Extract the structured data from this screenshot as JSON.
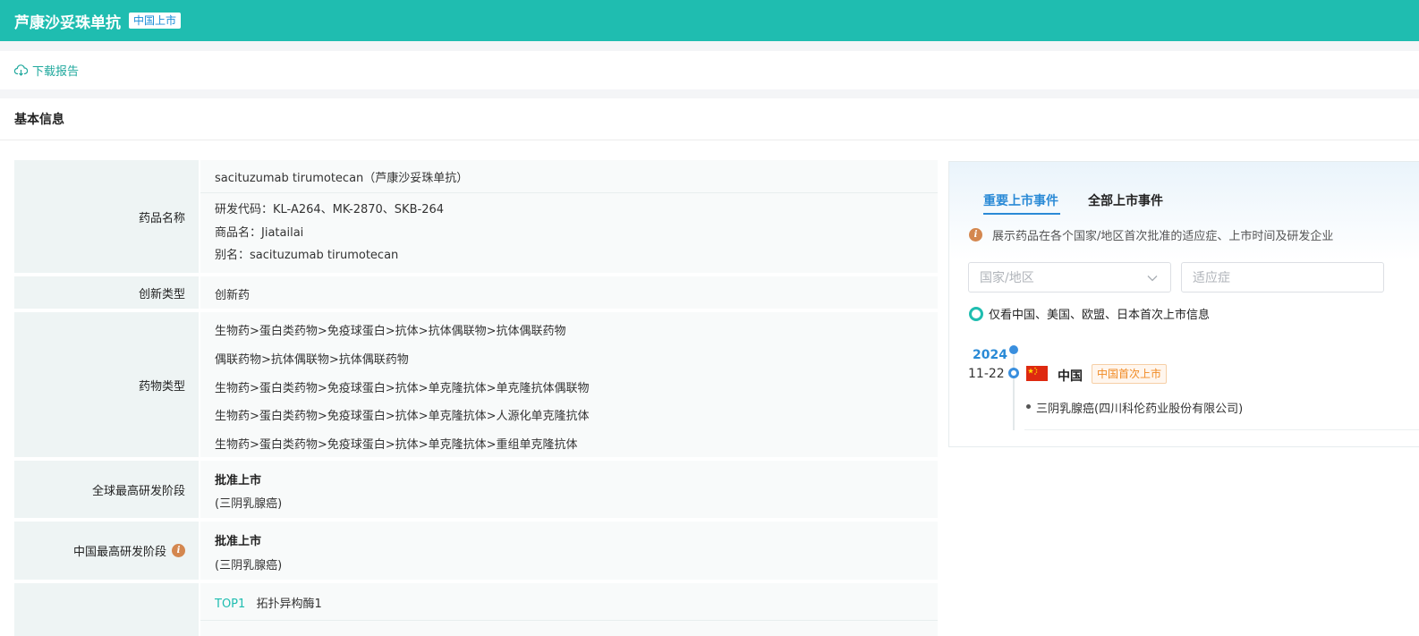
{
  "header": {
    "title": "芦康沙妥珠单抗",
    "badge": "中国上市"
  },
  "toolbar": {
    "download_label": "下载报告"
  },
  "section": {
    "title": "基本信息"
  },
  "drug_name": {
    "label": "药品名称",
    "generic": "sacituzumab tirumotecan（芦康沙妥珠单抗）",
    "code": "研发代码：KL-A264、MK-2870、SKB-264",
    "trade": "商品名：Jiatailai",
    "alias": "别名：sacituzumab tirumotecan"
  },
  "innovation": {
    "label": "创新类型",
    "value": "创新药"
  },
  "drug_type": {
    "label": "药物类型",
    "items": [
      "生物药>蛋白类药物>免疫球蛋白>抗体>抗体偶联物>抗体偶联药物",
      "偶联药物>抗体偶联物>抗体偶联药物",
      "生物药>蛋白类药物>免疫球蛋白>抗体>单克隆抗体>单克隆抗体偶联物",
      "生物药>蛋白类药物>免疫球蛋白>抗体>单克隆抗体>人源化单克隆抗体",
      "生物药>蛋白类药物>免疫球蛋白>抗体>单克隆抗体>重组单克隆抗体"
    ]
  },
  "global_stage": {
    "label": "全球最高研发阶段",
    "stage": "批准上市",
    "indication": "(三阴乳腺癌)"
  },
  "china_stage": {
    "label": "中国最高研发阶段",
    "stage": "批准上市",
    "indication": "(三阴乳腺癌)",
    "info_icon": "i"
  },
  "target": {
    "rank": "TOP1",
    "name": "拓扑异构酶1"
  },
  "launch": {
    "tabs": [
      "重要上市事件",
      "全部上市事件"
    ],
    "hint": "展示药品在各个国家/地区首次批准的适应症、上市时间及研发企业",
    "info_icon": "i",
    "country_placeholder": "国家/地区",
    "indication_placeholder": "适应症",
    "checkbox_label": "仅看中国、美国、欧盟、日本首次上市信息",
    "events": [
      {
        "year": "2024",
        "date": "11-22",
        "country": "中国",
        "tag": "中国首次上市",
        "detail": "三阴乳腺癌(四川科伦药业股份有限公司)"
      }
    ]
  },
  "colors": {
    "brand": "#1fbdb0",
    "accent": "#2a8ad6",
    "tag_orange": "#f08a24",
    "info": "#d4874f"
  }
}
